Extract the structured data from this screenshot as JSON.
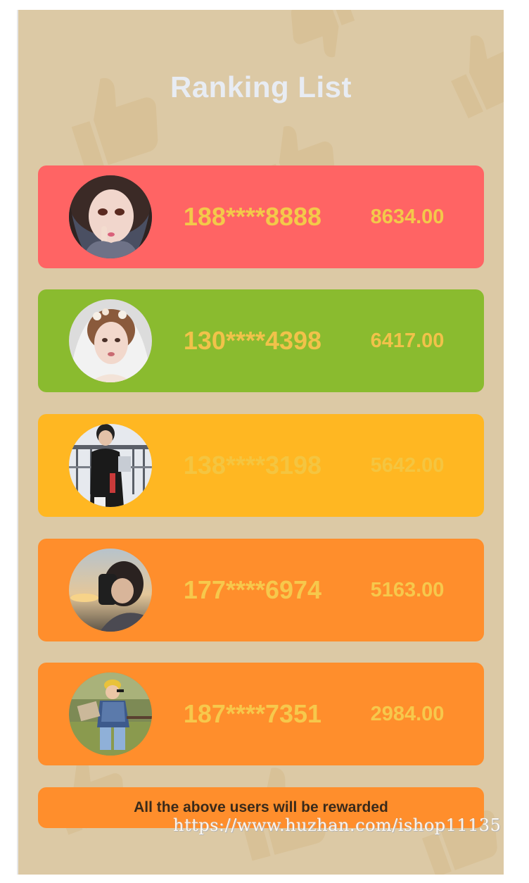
{
  "title": "Ranking List",
  "colors": {
    "background": "#dcc9a5",
    "title": "#e8ecf3",
    "text_gold": "#f4c542"
  },
  "rankings": [
    {
      "phone": "188****8888",
      "score": "8634.00",
      "card_color": "#ff6464",
      "text_color": "#f3c94a",
      "avatar": "girl-illustration-avatar"
    },
    {
      "phone": "130****4398",
      "score": "6417.00",
      "card_color": "#8abb2f",
      "text_color": "#f1c24a",
      "avatar": "bride-avatar"
    },
    {
      "phone": "138****3198",
      "score": "5642.00",
      "card_color": "#ffb722",
      "text_color": "#f4c540",
      "avatar": "boy-balcony-avatar"
    },
    {
      "phone": "177****6974",
      "score": "5163.00",
      "card_color": "#ff8e2c",
      "text_color": "#f6c84c",
      "avatar": "sunset-selfie-avatar"
    },
    {
      "phone": "187****7351",
      "score": "2984.00",
      "card_color": "#ff8e2c",
      "text_color": "#f6c84c",
      "avatar": "child-park-avatar"
    }
  ],
  "notice": {
    "text": "All the above users will be rewarded",
    "color": "#ff8e2c"
  },
  "watermark": "https://www.huzhan.com/ishop11135"
}
